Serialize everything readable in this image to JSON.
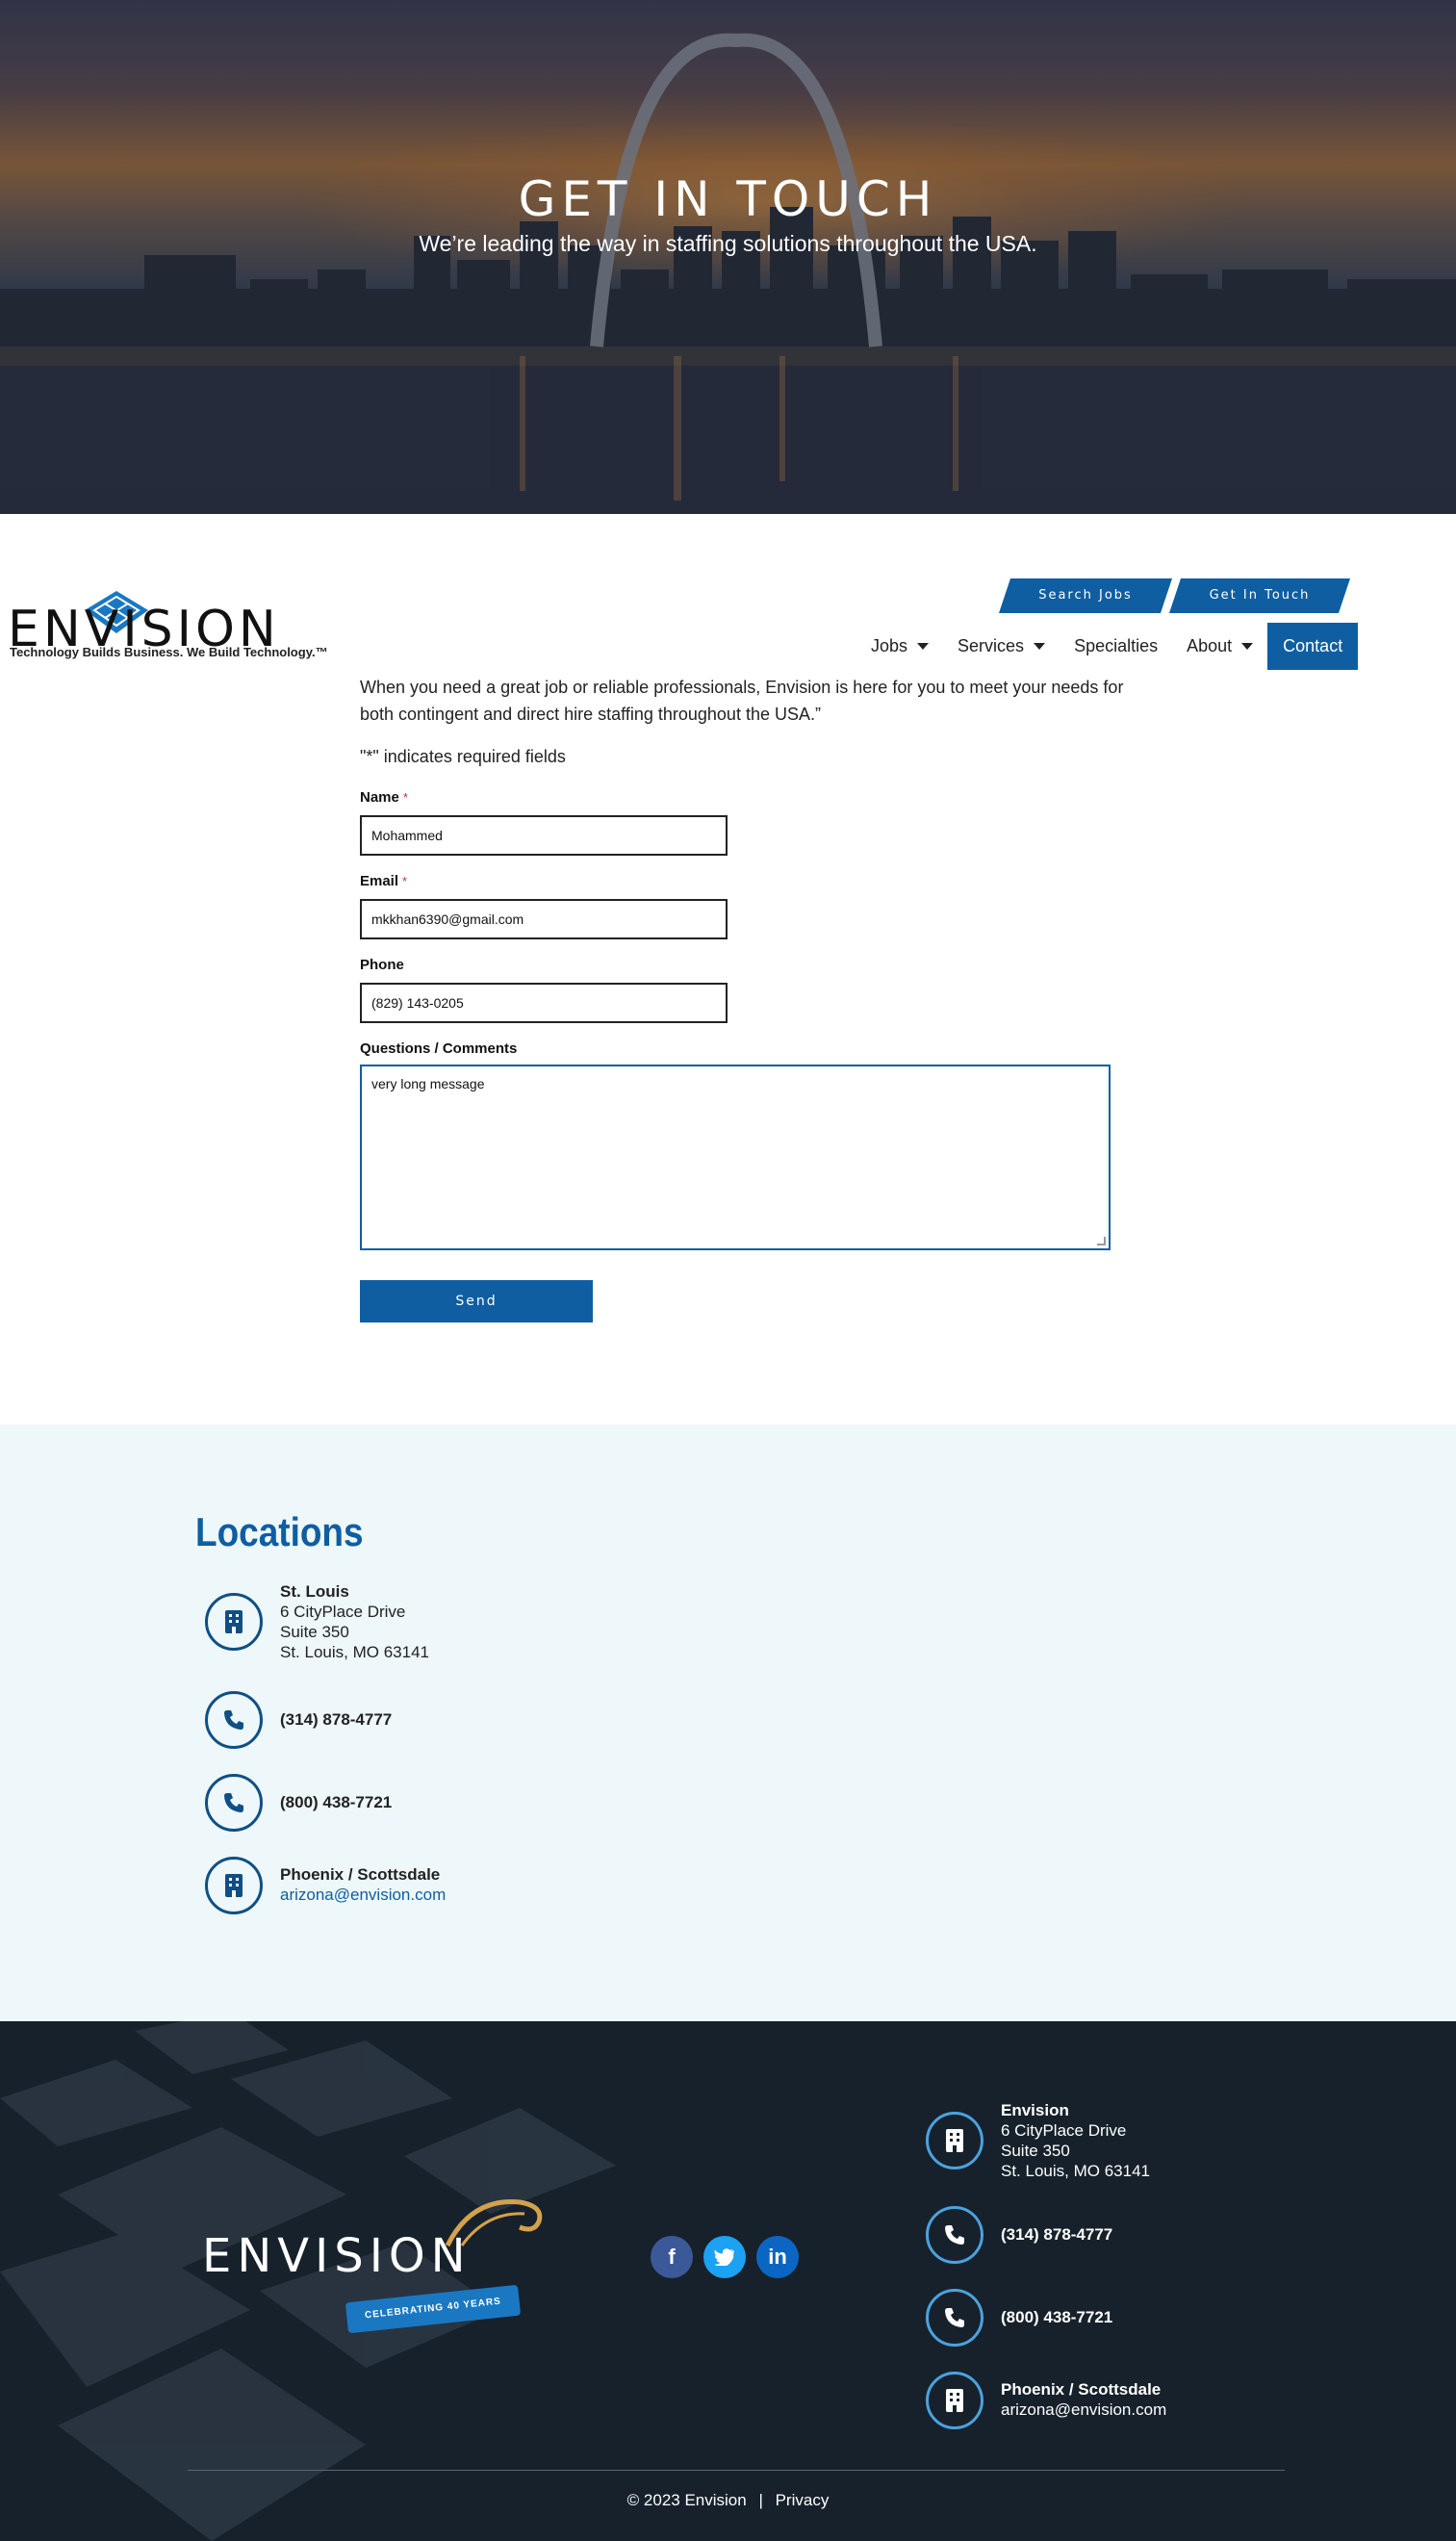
{
  "hero": {
    "title": "GET IN TOUCH",
    "subtitle": "We’re leading the way in staffing solutions throughout the USA."
  },
  "header": {
    "logo_text": "ENVISION",
    "logo_tagline": "Technology Builds Business. We Build Technology.™",
    "top_buttons": {
      "search_jobs": "Search Jobs",
      "get_in_touch": "Get In Touch"
    },
    "nav": [
      {
        "label": "Jobs",
        "has_dropdown": true
      },
      {
        "label": "Services",
        "has_dropdown": true
      },
      {
        "label": "Specialties",
        "has_dropdown": false
      },
      {
        "label": "About",
        "has_dropdown": true
      },
      {
        "label": "Contact",
        "has_dropdown": false,
        "active": true
      }
    ],
    "accent_color": "#0f5ea2"
  },
  "form": {
    "intro": "When you need a great job or reliable professionals, Envision is here for you to meet your needs for both contingent and direct hire staffing throughout the USA.”",
    "required_note": "\"*\" indicates required fields",
    "name": {
      "label": "Name",
      "required_mark": "*",
      "value": "Mohammed"
    },
    "email": {
      "label": "Email",
      "required_mark": "*",
      "value": "mkkhan6390@gmail.com"
    },
    "phone": {
      "label": "Phone",
      "value": "(829) 143-0205"
    },
    "comments": {
      "label": "Questions / Comments",
      "value": "very long message"
    },
    "submit_label": "Send"
  },
  "locations": {
    "title": "Locations",
    "items": [
      {
        "icon": "building-icon",
        "name": "St. Louis",
        "lines": [
          "6 CityPlace Drive",
          "Suite 350",
          "St. Louis, MO 63141"
        ]
      },
      {
        "icon": "phone-icon",
        "name": "(314) 878-4777"
      },
      {
        "icon": "phone-icon",
        "name": "(800) 438-7721"
      },
      {
        "icon": "building-icon",
        "name": "Phoenix / Scottsdale",
        "link": "arizona@envision.com"
      }
    ]
  },
  "footer": {
    "logo_text": "ENVISION",
    "ribbon": "CELEBRATING 40 YEARS",
    "social": [
      {
        "icon": "facebook-icon",
        "glyph": "f"
      },
      {
        "icon": "twitter-icon",
        "glyph": "t"
      },
      {
        "icon": "linkedin-icon",
        "glyph": "in"
      }
    ],
    "contacts": [
      {
        "icon": "building-icon",
        "name": "Envision",
        "lines": [
          "6 CityPlace Drive",
          "Suite 350",
          "St. Louis, MO 63141"
        ]
      },
      {
        "icon": "phone-icon",
        "name": "(314) 878-4777"
      },
      {
        "icon": "phone-icon",
        "name": "(800) 438-7721"
      },
      {
        "icon": "building-icon",
        "name": "Phoenix / Scottsdale",
        "link": "arizona@envision.com"
      }
    ],
    "copyright": "© 2023 Envision",
    "separator": "|",
    "privacy": "Privacy"
  }
}
